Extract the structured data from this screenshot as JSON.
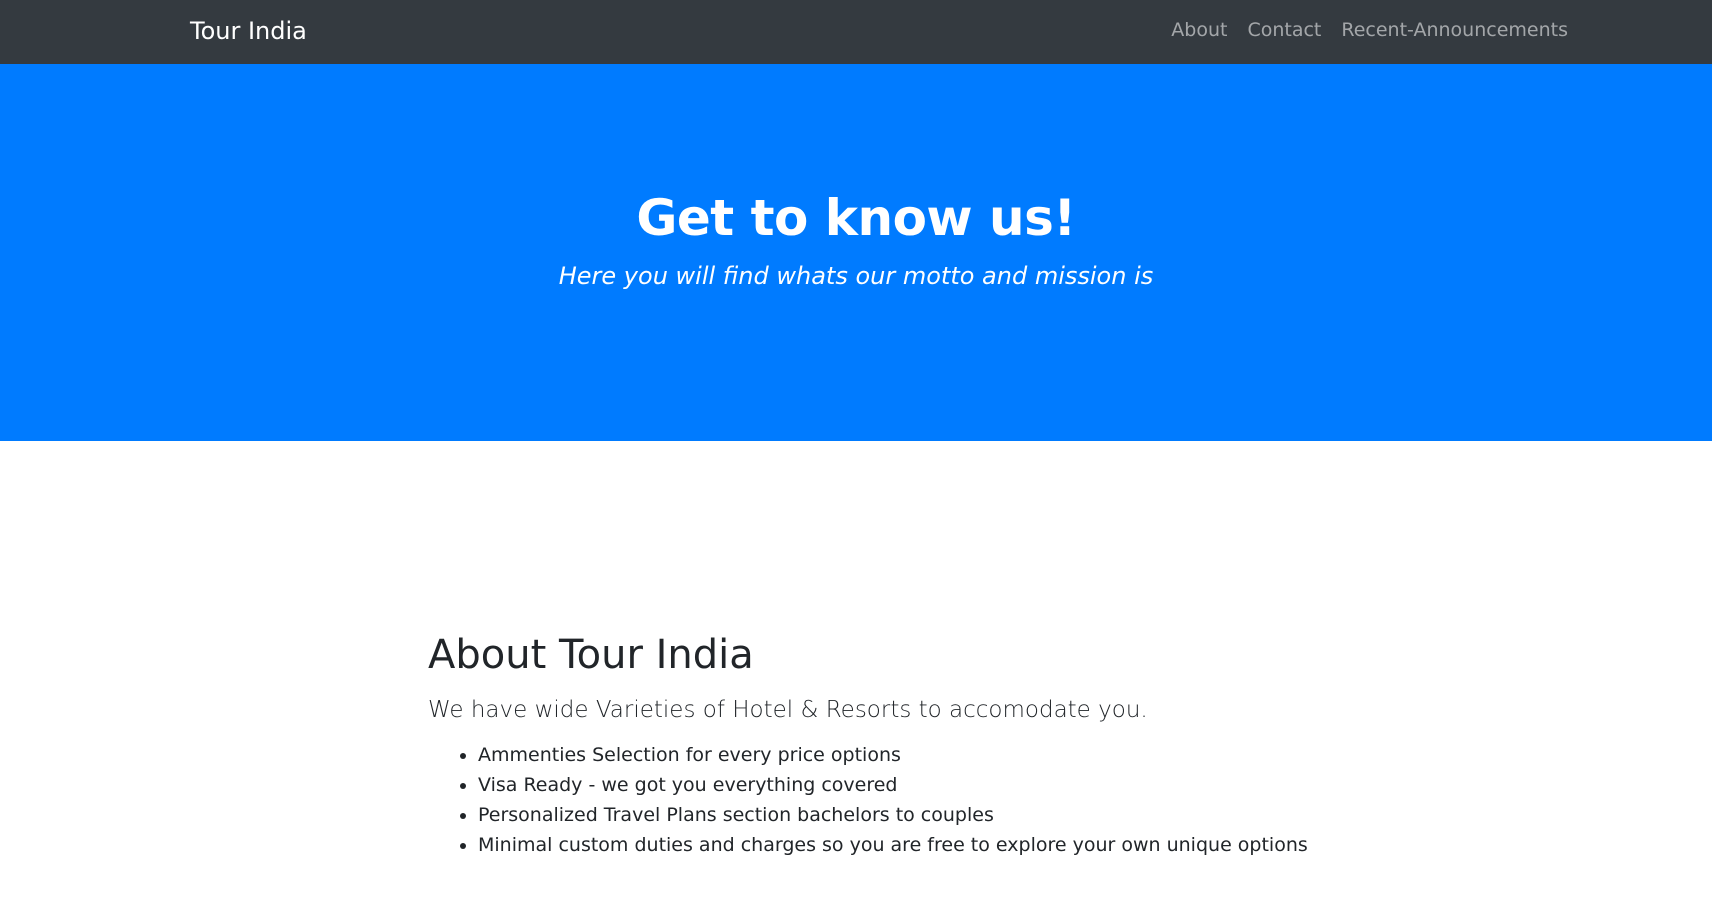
{
  "navbar": {
    "brand": "Tour India",
    "links": [
      "About",
      "Contact",
      "Recent-Announcements"
    ]
  },
  "hero": {
    "title": "Get to know us!",
    "subtitle": "Here you will find whats our motto and mission is"
  },
  "about": {
    "title": "About Tour India",
    "lead": "We have wide Varieties of Hotel & Resorts to accomodate you.",
    "features": [
      "Ammenties Selection for every price options",
      "Visa Ready - we got you everything covered",
      "Personalized Travel Plans section bachelors to couples",
      "Minimal custom duties and charges so you are free to explore your own unique options"
    ]
  },
  "colors": {
    "navbar_bg": "#343a40",
    "hero_bg": "#007bff",
    "text_dark": "#212529"
  }
}
